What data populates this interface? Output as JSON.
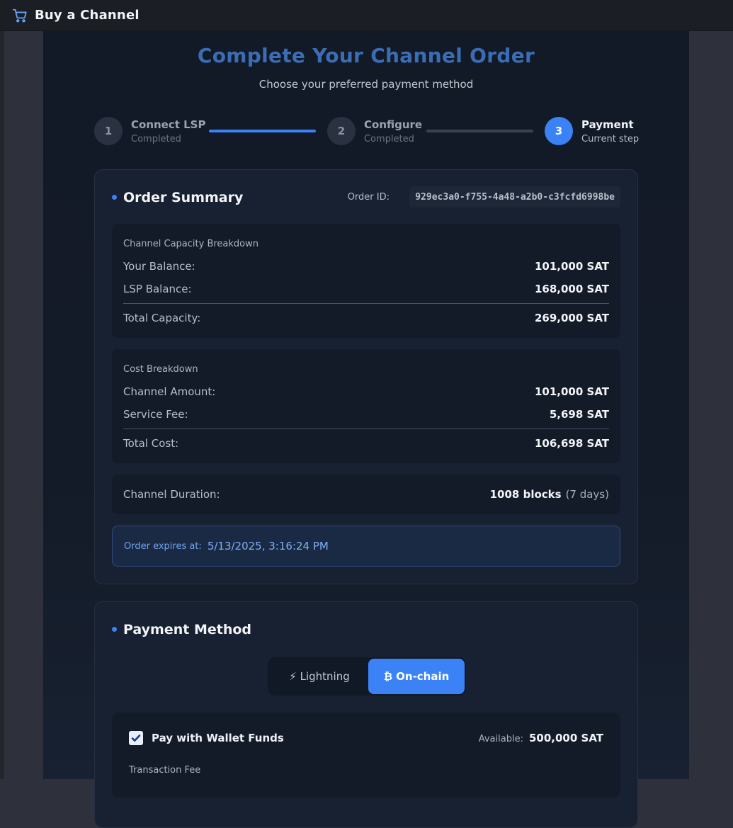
{
  "window": {
    "title": "Buy a Channel",
    "icon": "cart-icon"
  },
  "header": {
    "title_main": "Complete Your Channel Order",
    "subtitle": "Choose your preferred payment method"
  },
  "steps": [
    {
      "number": "1",
      "name": "Connect LSP",
      "status": "Completed"
    },
    {
      "number": "2",
      "name": "Configure",
      "status": "Completed"
    },
    {
      "number": "3",
      "name": "Payment",
      "status": "Current step"
    }
  ],
  "order_summary": {
    "title": "Order Summary",
    "order_id_label": "Order ID:",
    "order_id": "929ec3a0-f755-4a48-a2b0-c3fcfd6998be",
    "capacity": {
      "heading": "Channel Capacity Breakdown",
      "your_balance_label": "Your Balance:",
      "your_balance": "101,000 SAT",
      "lsp_balance_label": "LSP Balance:",
      "lsp_balance": "168,000 SAT",
      "total_label": "Total Capacity:",
      "total": "269,000 SAT"
    },
    "cost": {
      "heading": "Cost Breakdown",
      "channel_amount_label": "Channel Amount:",
      "channel_amount": "101,000 SAT",
      "service_fee_label": "Service Fee:",
      "service_fee": "5,698 SAT",
      "total_label": "Total Cost:",
      "total": "106,698 SAT"
    },
    "duration": {
      "label": "Channel Duration:",
      "blocks": "1008 blocks",
      "days": "(7 days)"
    },
    "expires": {
      "label": "Order expires at:",
      "value": "5/13/2025, 3:16:24 PM"
    }
  },
  "payment_method": {
    "title": "Payment Method",
    "options": [
      {
        "label": "⚡ Lightning",
        "selected": false
      },
      {
        "label": "₿ On-chain",
        "selected": true
      }
    ],
    "wallet": {
      "label": "Pay with Wallet Funds",
      "checked": true,
      "available_label": "Available:",
      "available": "500,000 SAT",
      "fee_heading": "Transaction Fee"
    }
  },
  "colors": {
    "accent": "#3b82f6",
    "background": "#141b28",
    "card": "#182132"
  }
}
